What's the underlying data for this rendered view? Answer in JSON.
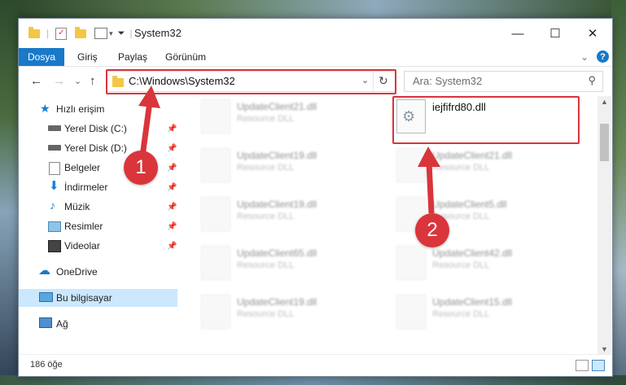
{
  "window": {
    "title": "System32",
    "minimize_glyph": "—",
    "maximize_glyph": "☐",
    "close_glyph": "✕"
  },
  "ribbon": {
    "tabs": [
      "Dosya",
      "Giriş",
      "Paylaş",
      "Görünüm"
    ],
    "help_glyph": "?",
    "collapse_glyph": "⌄"
  },
  "navigation": {
    "back_glyph": "←",
    "forward_glyph": "→",
    "recent_glyph": "⌄",
    "up_glyph": "↑",
    "address": "C:\\Windows\\System32",
    "refresh_glyph": "↻",
    "search_placeholder": "Ara: System32"
  },
  "sidebar": {
    "quick_access": "Hızlı erişim",
    "items": [
      {
        "label": "Yerel Disk (C:)",
        "icon": "drive-icon"
      },
      {
        "label": "Yerel Disk (D:)",
        "icon": "drive-icon"
      },
      {
        "label": "Belgeler",
        "icon": "documents-icon"
      },
      {
        "label": "İndirmeler",
        "icon": "downloads-icon"
      },
      {
        "label": "Müzik",
        "icon": "music-icon"
      },
      {
        "label": "Resimler",
        "icon": "pictures-icon"
      },
      {
        "label": "Videolar",
        "icon": "videos-icon"
      }
    ],
    "onedrive": "OneDrive",
    "this_pc": "Bu bilgisayar",
    "network": "Ağ"
  },
  "files": [
    {
      "name": "UpdateClient21.dll",
      "type": "Resource DLL"
    },
    {
      "name": "iejfifrd80.dll",
      "type": ""
    },
    {
      "name": "UpdateClient19.dll",
      "type": "Resource DLL"
    },
    {
      "name": "UpdateClient21.dll",
      "type": "Resource DLL"
    },
    {
      "name": "UpdateClient19.dll",
      "type": "Resource DLL"
    },
    {
      "name": "UpdateClient5.dll",
      "type": "Resource DLL"
    },
    {
      "name": "UpdateClient65.dll",
      "type": "Resource DLL"
    },
    {
      "name": "UpdateClient42.dll",
      "type": "Resource DLL"
    },
    {
      "name": "UpdateClient19.dll",
      "type": "Resource DLL"
    },
    {
      "name": "UpdateClient15.dll",
      "type": "Resource DLL"
    }
  ],
  "status": {
    "item_count": "186 öğe"
  },
  "callouts": [
    "1",
    "2"
  ],
  "colors": {
    "accent": "#1979ca",
    "highlight_red": "#d9353b",
    "selected_bg": "#cce8ff"
  }
}
